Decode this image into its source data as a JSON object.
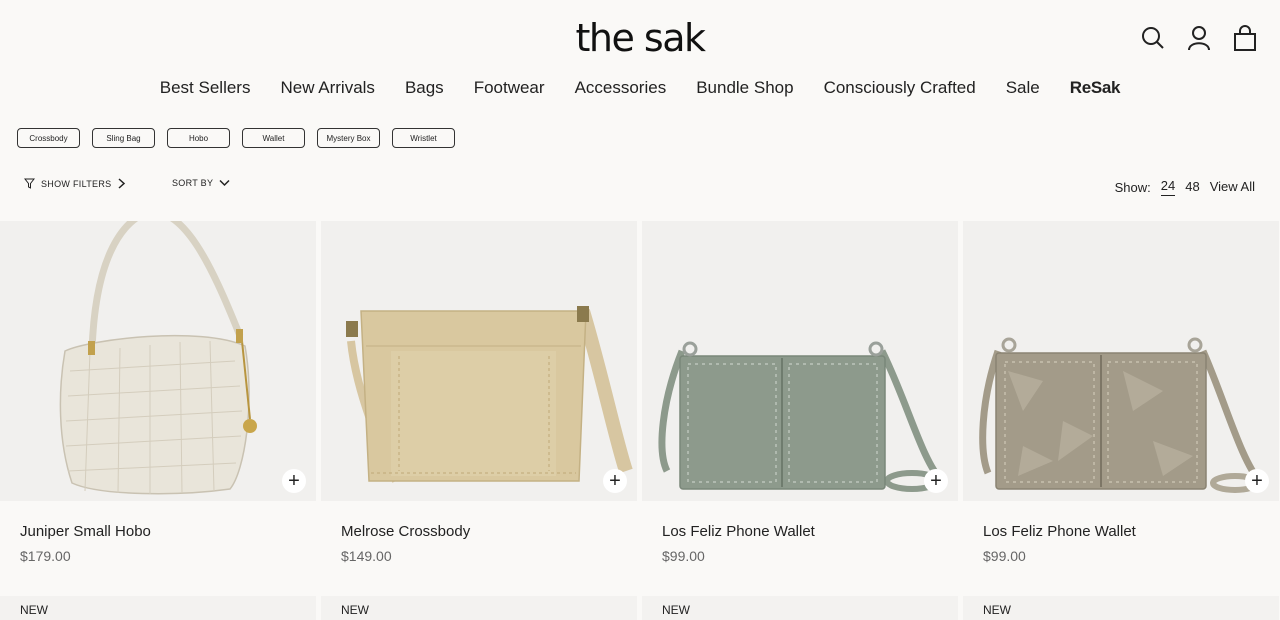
{
  "brand": {
    "logo": "the sak"
  },
  "header_icons": [
    "search-icon",
    "account-icon",
    "bag-icon"
  ],
  "nav": [
    "Best Sellers",
    "New Arrivals",
    "Bags",
    "Footwear",
    "Accessories",
    "Bundle Shop",
    "Consciously Crafted",
    "Sale",
    "ReSak"
  ],
  "chips": [
    "Crossbody",
    "Sling Bag",
    "Hobo",
    "Wallet",
    "Mystery Box",
    "Wristlet"
  ],
  "toolbar": {
    "filters_label": "SHOW FILTERS",
    "sort_label": "SORT BY",
    "show_label": "Show:",
    "show_options": [
      "24",
      "48",
      "View All"
    ],
    "show_selected": "24"
  },
  "products": [
    {
      "name": "Juniper Small Hobo",
      "price": "$179.00",
      "color": "#e9e5da"
    },
    {
      "name": "Melrose Crossbody",
      "price": "$149.00",
      "color": "#d9c89f"
    },
    {
      "name": "Los Feliz Phone Wallet",
      "price": "$99.00",
      "color": "#8d9a8c"
    },
    {
      "name": "Los Feliz Phone Wallet",
      "price": "$99.00",
      "color": "#a39b89"
    }
  ],
  "next_row_badges": [
    "NEW",
    "NEW",
    "NEW",
    "NEW"
  ],
  "add_symbol": "+"
}
